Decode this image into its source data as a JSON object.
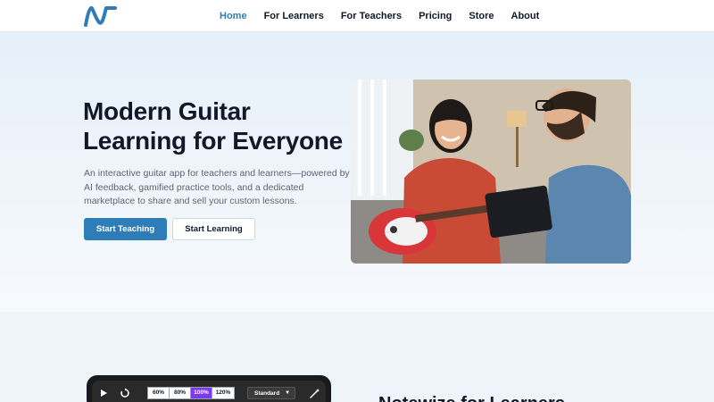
{
  "nav": {
    "logo_icon": "notewize-n-logo",
    "items": [
      {
        "label": "Home",
        "active": true
      },
      {
        "label": "For Learners",
        "active": false
      },
      {
        "label": "For Teachers",
        "active": false
      },
      {
        "label": "Pricing",
        "active": false
      },
      {
        "label": "Store",
        "active": false
      },
      {
        "label": "About",
        "active": false
      }
    ]
  },
  "hero": {
    "title": "Modern Guitar Learning for Everyone",
    "description": "An interactive guitar app for teachers and learners—powered by AI feedback, gamified practice tools, and a dedicated marketplace to share and sell your custom lessons.",
    "primary_button": "Start Teaching",
    "secondary_button": "Start Learning"
  },
  "player": {
    "speeds": [
      "60%",
      "80%",
      "100%",
      "120%"
    ],
    "selected_speed": "100%",
    "mode": "Standard"
  },
  "learners_section": {
    "title": "Notewize for Learners"
  },
  "colors": {
    "accent": "#2f7db8",
    "speed_selected": "#7c3aed"
  }
}
